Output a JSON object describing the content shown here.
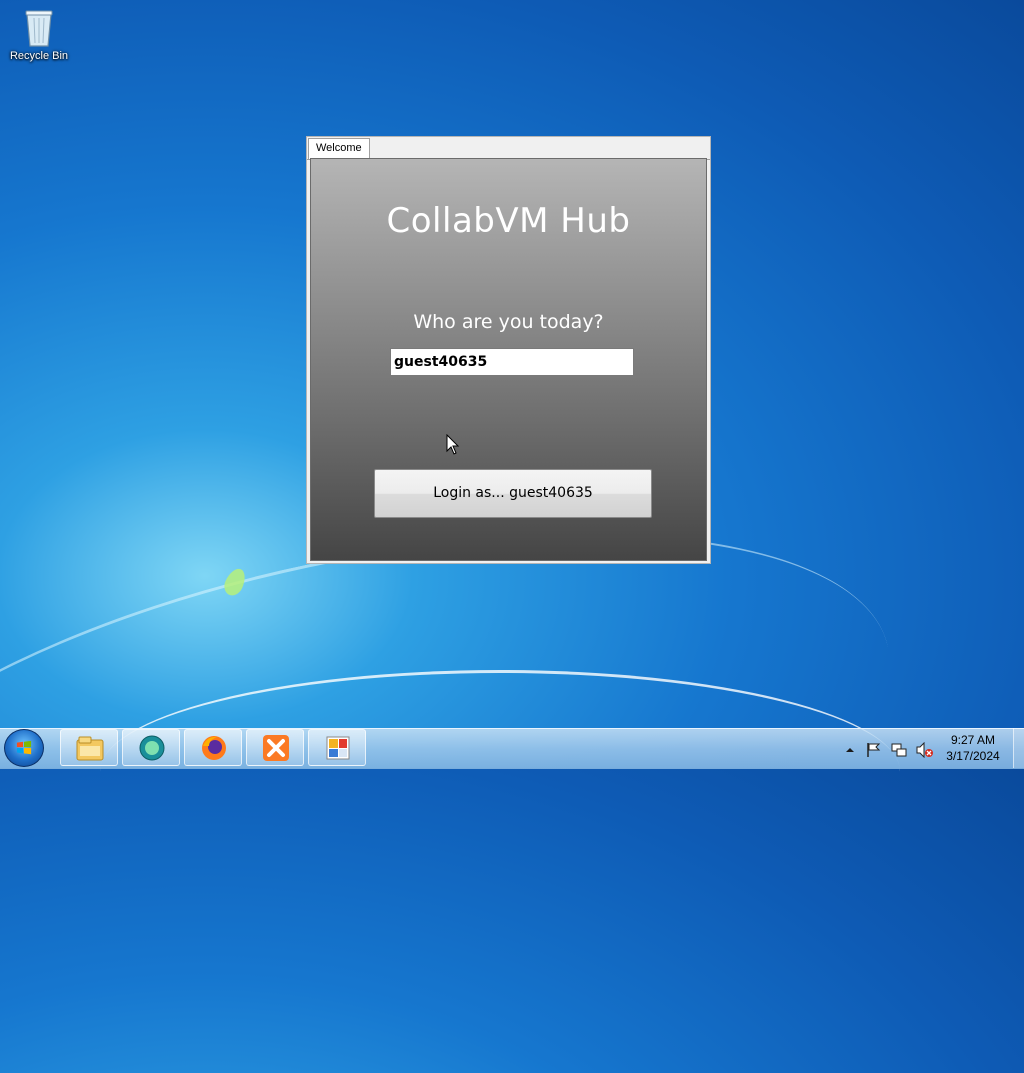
{
  "desktop": {
    "recycle_bin_label": "Recycle Bin"
  },
  "window": {
    "tab_label": "Welcome",
    "title": "CollabVM Hub",
    "prompt": "Who are you today?",
    "username_value": "guest40635",
    "login_button_label": "Login as... guest40635"
  },
  "taskbar": {
    "apps": [
      "windows-explorer-icon",
      "collabvm-app-icon",
      "firefox-icon",
      "xampp-icon",
      "control-panel-icon"
    ],
    "clock_time": "9:27 AM",
    "clock_date": "3/17/2024"
  },
  "colors": {
    "desktop_blue": "#1677cf",
    "panel_top": "#b5b5b5",
    "panel_bottom": "#454545"
  }
}
